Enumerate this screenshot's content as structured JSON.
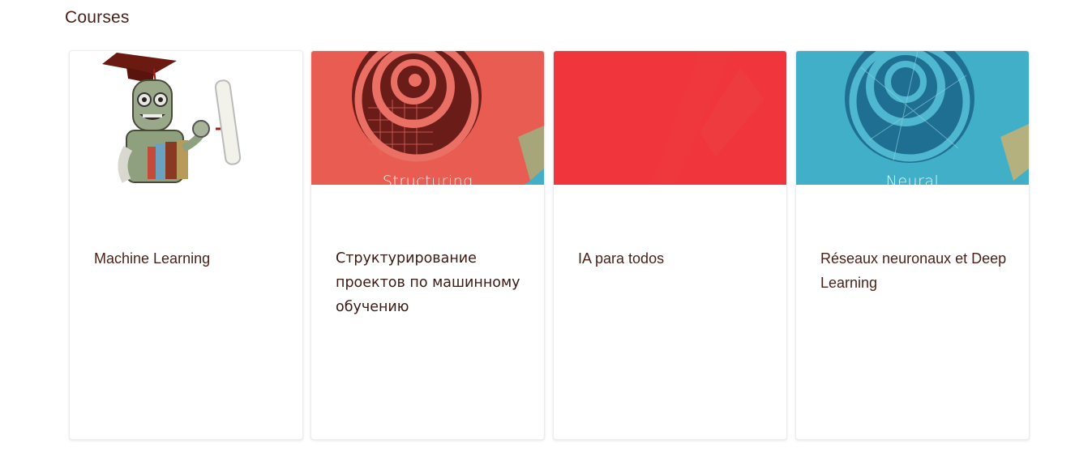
{
  "section": {
    "title": "Courses"
  },
  "courses": [
    {
      "title": "Machine Learning",
      "image": "robot-graduate-illustration",
      "image_text": ""
    },
    {
      "title": "Структурирование проектов по машинному обучению",
      "image": "red-spiral-artwork",
      "image_text": "Structuring"
    },
    {
      "title": "IA para todos",
      "image": "red-abstract-artwork",
      "image_text": ""
    },
    {
      "title": "Réseaux neuronaux et Deep Learning",
      "image": "blue-spiral-artwork",
      "image_text": "Neural"
    }
  ],
  "colors": {
    "title_text": "#4a1f17",
    "card_border": "#ececec",
    "red_coral": "#e85c51",
    "bright_red": "#f0363c",
    "teal": "#41afc8"
  }
}
